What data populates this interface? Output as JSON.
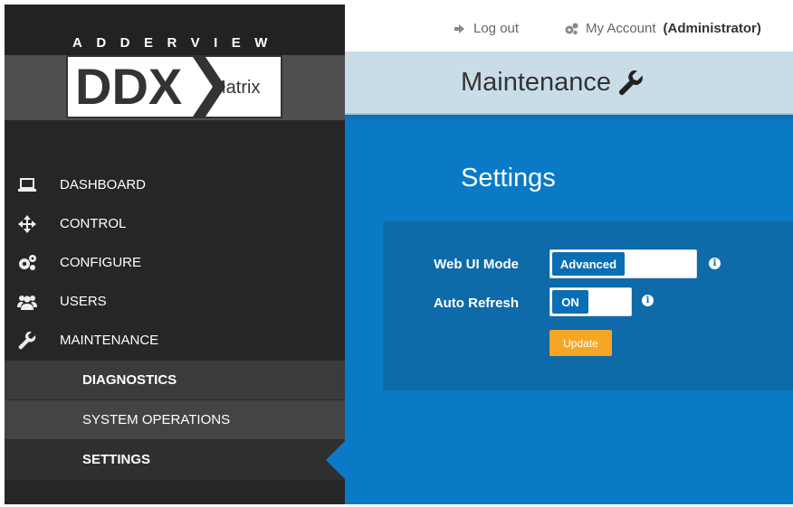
{
  "brand": {
    "name": "ADDERVIEW",
    "logo_main": "DDX",
    "logo_sub": "Matrix"
  },
  "header": {
    "logout_label": "Log out",
    "account_label": "My Account",
    "account_role": "(Administrator)"
  },
  "page": {
    "title": "Maintenance",
    "section_title": "Settings"
  },
  "sidebar": {
    "items": [
      {
        "label": "DASHBOARD",
        "icon": "laptop-icon"
      },
      {
        "label": "CONTROL",
        "icon": "move-arrows-icon"
      },
      {
        "label": "CONFIGURE",
        "icon": "gears-icon"
      },
      {
        "label": "USERS",
        "icon": "users-icon"
      },
      {
        "label": "MAINTENANCE",
        "icon": "wrench-icon"
      }
    ],
    "subitems": [
      {
        "label": "DIAGNOSTICS"
      },
      {
        "label": "SYSTEM OPERATIONS"
      },
      {
        "label": "SETTINGS",
        "active": true
      }
    ]
  },
  "settings": {
    "web_ui_mode": {
      "label": "Web UI Mode",
      "value": "Advanced"
    },
    "auto_refresh": {
      "label": "Auto Refresh",
      "value": "ON"
    },
    "update_label": "Update"
  },
  "colors": {
    "accent": "#0a7ac7",
    "panel": "#0e6aa8",
    "update": "#f6a623",
    "sidebar": "#262626"
  }
}
